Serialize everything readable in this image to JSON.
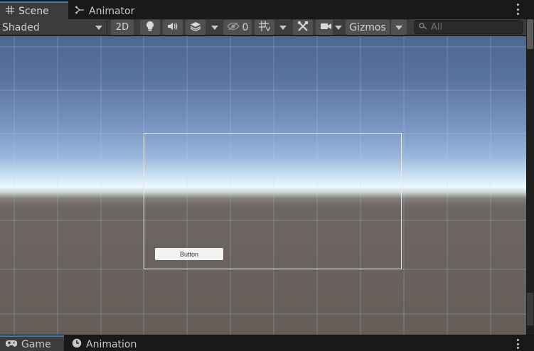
{
  "tabs": [
    {
      "label": "Scene",
      "icon": "grid-icon",
      "active": true
    },
    {
      "label": "Animator",
      "icon": "animator-icon",
      "active": false
    }
  ],
  "toolbar": {
    "draw_mode": "Shaded",
    "mode_2d": "2D",
    "hidden_count": "0",
    "gizmos": "Gizmos",
    "search_placeholder": "All"
  },
  "scene": {
    "button_label": "Button"
  },
  "bottom_tabs": [
    {
      "label": "Game",
      "icon": "gamepad-icon",
      "active": true
    },
    {
      "label": "Animation",
      "icon": "clock-icon",
      "active": false
    }
  ],
  "colors": {
    "accent": "#3a79bb",
    "panel": "#3c3c3c",
    "background": "#191919"
  }
}
